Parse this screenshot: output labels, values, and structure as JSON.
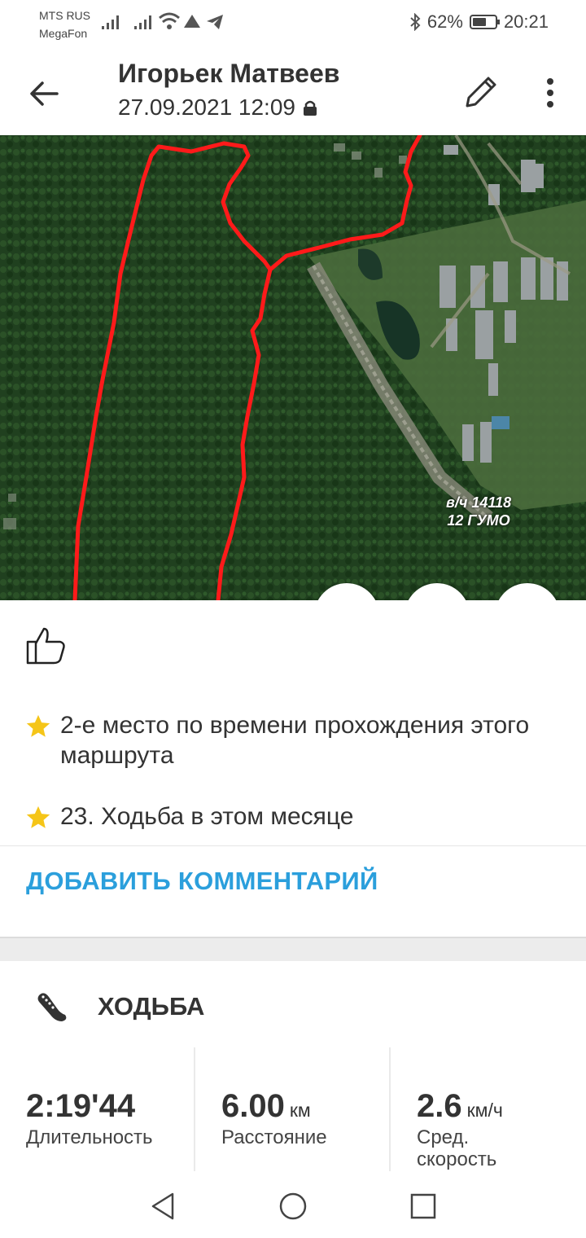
{
  "status_bar": {
    "carrier_1": "MTS RUS",
    "carrier_2": "MegaFon",
    "battery": "62%",
    "battery_level": 0.62,
    "time": "20:21"
  },
  "header": {
    "title": "Игорьек Матвеев",
    "datetime": "27.09.2021 12:09"
  },
  "map": {
    "label_line1": "в/ч 14118",
    "label_line2": "12 ГУМО",
    "route_color": "#ff1a1a"
  },
  "achievements": [
    {
      "text": "2-е место по времени прохождения этого маршрута"
    },
    {
      "text": "23. Ходьба в этом месяце"
    }
  ],
  "add_comment_label": "ДОБАВИТЬ КОММЕНТАРИЙ",
  "activity": {
    "type": "ХОДЬБА",
    "stats": [
      {
        "value": "2:19'44",
        "unit": "",
        "label": "Длительность"
      },
      {
        "value": "6.00",
        "unit": "км",
        "label": "Расстояние"
      },
      {
        "value": "2.6",
        "unit": "км/ч",
        "label": "Сред. скорость"
      }
    ]
  },
  "colors": {
    "accent": "#2b9fdc",
    "star": "#f5c518"
  }
}
